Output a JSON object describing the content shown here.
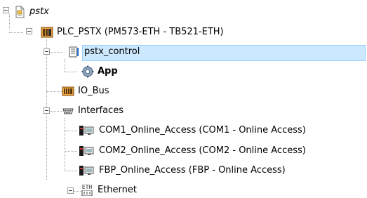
{
  "tree": {
    "project": {
      "label": "pstx",
      "icon": "project-file-icon"
    },
    "plc": {
      "label": "PLC_PSTX (PM573-ETH - TB521-ETH)",
      "icon": "plc-device-icon"
    },
    "control": {
      "label": "pstx_control",
      "icon": "application-icon",
      "selected": true
    },
    "app": {
      "label": "App",
      "icon": "gear-icon"
    },
    "iobus": {
      "label": "IO_Bus",
      "icon": "io-bus-icon"
    },
    "interfaces": {
      "label": "Interfaces",
      "icon": "interface-connector-icon"
    },
    "com1": {
      "label": "COM1_Online_Access (COM1 - Online Access)",
      "icon": "online-access-icon"
    },
    "com2": {
      "label": "COM2_Online_Access (COM2 - Online Access)",
      "icon": "online-access-icon"
    },
    "fbp": {
      "label": "FBP_Online_Access (FBP - Online Access)",
      "icon": "online-access-icon"
    },
    "ethernet": {
      "label": "Ethernet",
      "icon": "ethernet-icon",
      "icon_text": "ETH"
    }
  }
}
